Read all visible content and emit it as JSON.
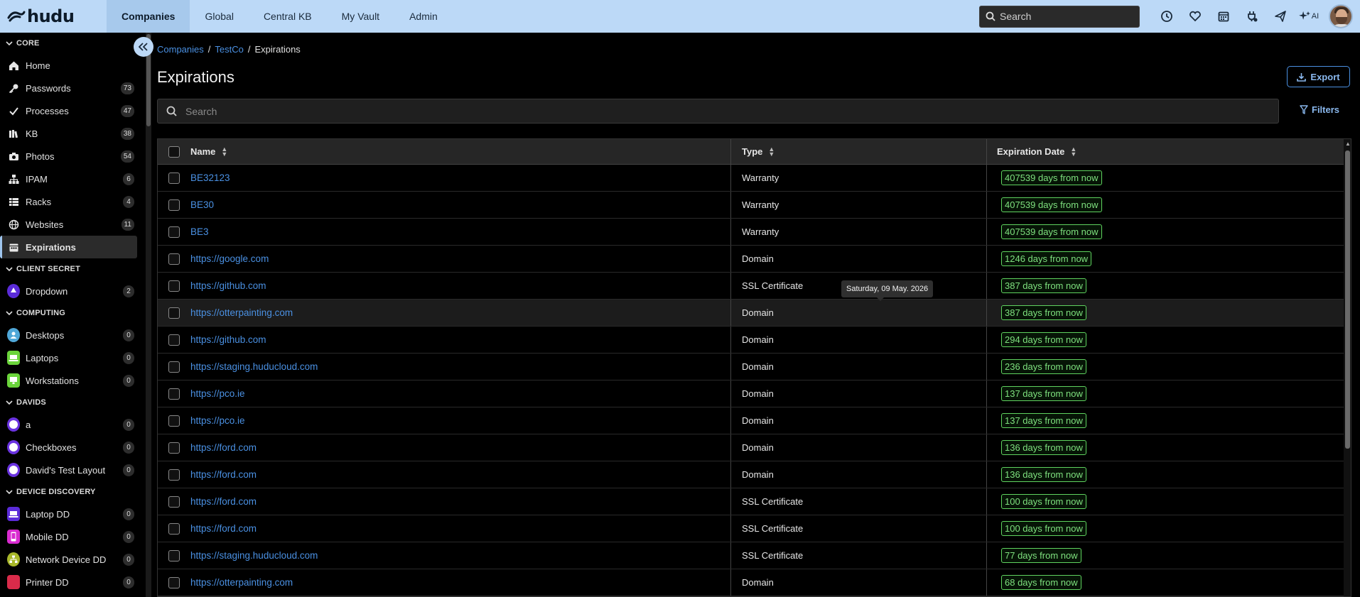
{
  "app": {
    "logo_text": "hudu"
  },
  "topnav": {
    "items": [
      "Companies",
      "Global",
      "Central KB",
      "My Vault",
      "Admin"
    ],
    "active": "Companies",
    "search_placeholder": "Search",
    "ai_label": "AI"
  },
  "sidebar": {
    "sections": [
      {
        "title": "CORE",
        "items": [
          {
            "label": "Home",
            "icon": "home-icon",
            "badge": ""
          },
          {
            "label": "Passwords",
            "icon": "key-icon",
            "badge": "73"
          },
          {
            "label": "Processes",
            "icon": "check-icon",
            "badge": "47"
          },
          {
            "label": "KB",
            "icon": "books-icon",
            "badge": "38"
          },
          {
            "label": "Photos",
            "icon": "camera-icon",
            "badge": "54"
          },
          {
            "label": "IPAM",
            "icon": "network-icon",
            "badge": "6"
          },
          {
            "label": "Racks",
            "icon": "rack-icon",
            "badge": "4"
          },
          {
            "label": "Websites",
            "icon": "globe-icon",
            "badge": "11"
          },
          {
            "label": "Expirations",
            "icon": "calendar-icon",
            "badge": "",
            "active": true
          }
        ]
      },
      {
        "title": "CLIENT SECRET",
        "items": [
          {
            "label": "Dropdown",
            "icon": "dropdown-icon",
            "badge": "2"
          }
        ]
      },
      {
        "title": "COMPUTING",
        "items": [
          {
            "label": "Desktops",
            "icon": "desktops-icon",
            "badge": "0"
          },
          {
            "label": "Laptops",
            "icon": "laptop-icon",
            "badge": "0"
          },
          {
            "label": "Workstations",
            "icon": "workstation-icon",
            "badge": "0"
          }
        ]
      },
      {
        "title": "DAVIDS",
        "items": [
          {
            "label": "a",
            "icon": "circle-icon",
            "badge": "0"
          },
          {
            "label": "Checkboxes",
            "icon": "circle-icon",
            "badge": "0"
          },
          {
            "label": "David's Test Layout",
            "icon": "circle-icon",
            "badge": "0"
          }
        ]
      },
      {
        "title": "DEVICE DISCOVERY",
        "items": [
          {
            "label": "Laptop DD",
            "icon": "laptop-dd-icon",
            "badge": "0"
          },
          {
            "label": "Mobile DD",
            "icon": "mobile-icon",
            "badge": "0"
          },
          {
            "label": "Network Device DD",
            "icon": "network-device-icon",
            "badge": "0"
          },
          {
            "label": "Printer DD",
            "icon": "printer-icon",
            "badge": "0"
          }
        ]
      }
    ]
  },
  "breadcrumb": {
    "company_root": "Companies",
    "company": "TestCo",
    "current": "Expirations"
  },
  "page": {
    "title": "Expirations",
    "export_label": "Export",
    "search_placeholder": "Search",
    "filters_label": "Filters"
  },
  "table": {
    "columns": [
      "Name",
      "Type",
      "Expiration Date"
    ],
    "rows": [
      {
        "name": "BE32123",
        "type": "Warranty",
        "expires": "407539 days from now"
      },
      {
        "name": "BE30",
        "type": "Warranty",
        "expires": "407539 days from now"
      },
      {
        "name": "BE3",
        "type": "Warranty",
        "expires": "407539 days from now"
      },
      {
        "name": "https://google.com",
        "type": "Domain",
        "expires": "1246 days from now"
      },
      {
        "name": "https://github.com",
        "type": "SSL Certificate",
        "expires": "387 days from now"
      },
      {
        "name": "https://otterpainting.com",
        "type": "Domain",
        "expires": "387 days from now"
      },
      {
        "name": "https://github.com",
        "type": "Domain",
        "expires": "294 days from now"
      },
      {
        "name": "https://staging.huducloud.com",
        "type": "Domain",
        "expires": "236 days from now"
      },
      {
        "name": "https://pco.ie",
        "type": "Domain",
        "expires": "137 days from now"
      },
      {
        "name": "https://pco.ie",
        "type": "Domain",
        "expires": "137 days from now"
      },
      {
        "name": "https://ford.com",
        "type": "Domain",
        "expires": "136 days from now"
      },
      {
        "name": "https://ford.com",
        "type": "Domain",
        "expires": "136 days from now"
      },
      {
        "name": "https://ford.com",
        "type": "SSL Certificate",
        "expires": "100 days from now"
      },
      {
        "name": "https://ford.com",
        "type": "SSL Certificate",
        "expires": "100 days from now"
      },
      {
        "name": "https://staging.huducloud.com",
        "type": "SSL Certificate",
        "expires": "77 days from now"
      },
      {
        "name": "https://otterpainting.com",
        "type": "Domain",
        "expires": "68 days from now"
      }
    ],
    "tooltip": "Saturday, 09 May. 2026"
  }
}
